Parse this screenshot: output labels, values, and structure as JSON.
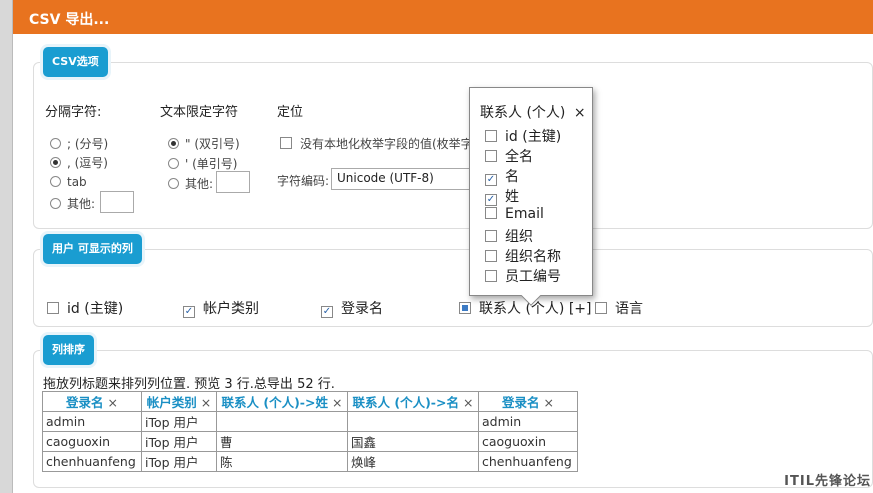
{
  "dialog": {
    "title": "CSV 导出..."
  },
  "csv_options": {
    "legend": "CSV选项",
    "separator": {
      "header": "分隔字符:",
      "options": [
        {
          "label": "; (分号)",
          "selected": false
        },
        {
          "label": ", (逗号)",
          "selected": true
        },
        {
          "label": "tab",
          "selected": false
        },
        {
          "label": "其他:",
          "selected": false
        }
      ]
    },
    "text_qualifier": {
      "header": "文本限定字符",
      "options": [
        {
          "label": "\" (双引号)",
          "selected": true
        },
        {
          "label": "' (单引号)",
          "selected": false
        },
        {
          "label": "其他:",
          "selected": false
        }
      ]
    },
    "localization": {
      "header": "定位",
      "checkbox_label": "没有本地化枚举字段的值(枚举字",
      "encoding_label": "字符编码:",
      "encoding_value": "Unicode (UTF-8)"
    }
  },
  "visible_columns": {
    "legend": "用户 可显示的列",
    "items": [
      {
        "label": "id (主键)",
        "checked": false
      },
      {
        "label": "帐户类别",
        "checked": true
      },
      {
        "label": "登录名",
        "checked": true
      },
      {
        "label": "联系人 (个人) [+]",
        "checked": "partial"
      },
      {
        "label": "语言",
        "checked": false
      }
    ]
  },
  "popup": {
    "title": "联系人 (个人)",
    "close": "×",
    "items": [
      {
        "label": "id (主键)",
        "checked": false
      },
      {
        "label": "全名",
        "checked": false
      },
      {
        "label": "名",
        "checked": true
      },
      {
        "label": "姓",
        "checked": true
      },
      {
        "label": "Email",
        "checked": false
      },
      {
        "label": "组织",
        "checked": false
      },
      {
        "label": "组织名称",
        "checked": false
      },
      {
        "label": "员工编号",
        "checked": false
      }
    ]
  },
  "column_order": {
    "legend": "列排序",
    "hint": "拖放列标题来排列列位置. 预览 3 行.总导出 52 行.",
    "remove_symbol": "×",
    "headers": [
      "登录名",
      "帐户类别",
      "联系人 (个人)->姓",
      "联系人 (个人)->名",
      "登录名"
    ],
    "rows": [
      [
        "admin",
        "iTop 用户",
        "",
        "",
        "admin"
      ],
      [
        "caoguoxin",
        "iTop 用户",
        "曹",
        "国鑫",
        "caoguoxin"
      ],
      [
        "chenhuanfeng",
        "iTop 用户",
        "陈",
        "焕峰",
        "chenhuanfeng"
      ]
    ]
  },
  "watermark": "ITIL先锋论坛"
}
